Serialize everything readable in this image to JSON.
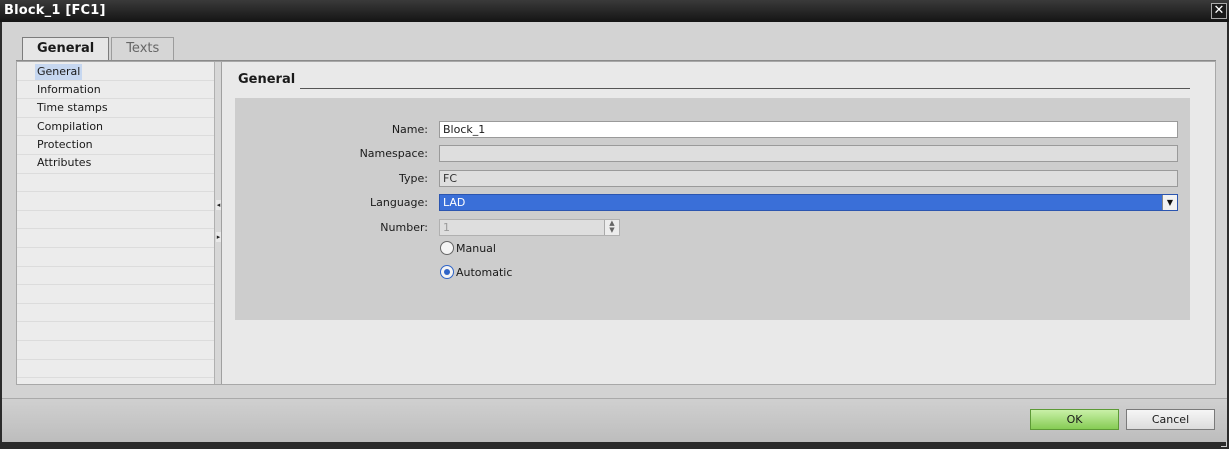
{
  "window": {
    "title": "Block_1 [FC1]",
    "close_glyph": "✕"
  },
  "tabs": [
    {
      "label": "General",
      "active": true
    },
    {
      "label": "Texts",
      "active": false
    }
  ],
  "nav": {
    "items": [
      {
        "label": "General",
        "selected": true
      },
      {
        "label": "Information"
      },
      {
        "label": "Time stamps"
      },
      {
        "label": "Compilation"
      },
      {
        "label": "Protection"
      },
      {
        "label": "Attributes"
      }
    ]
  },
  "section": {
    "title": "General"
  },
  "form": {
    "name": {
      "label": "Name:",
      "value": "Block_1"
    },
    "namespace": {
      "label": "Namespace:",
      "value": ""
    },
    "type": {
      "label": "Type:",
      "value": "FC"
    },
    "language": {
      "label": "Language:",
      "value": "LAD",
      "arrow": "▼"
    },
    "number": {
      "label": "Number:",
      "value": "1",
      "spin_up": "▲",
      "spin_down": "▼"
    },
    "radios": [
      {
        "label": "Manual",
        "checked": false
      },
      {
        "label": "Automatic",
        "checked": true
      }
    ]
  },
  "buttons": {
    "ok": "OK",
    "cancel": "Cancel"
  },
  "colors": {
    "selection": "#3a6fd8",
    "ok_button": "#86cc55",
    "radio_checked": "#2f64c8"
  }
}
